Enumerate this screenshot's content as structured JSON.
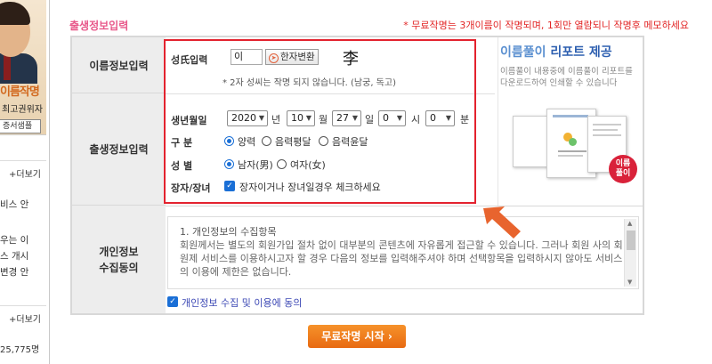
{
  "sidebar": {
    "banner_title": "이름작명",
    "banner_sub": "최고권위자",
    "sample_button": "증서샘플",
    "section1_more": "+더보기",
    "section1_lines": [
      "비스 안",
      "우는 이",
      "스 개시",
      "변경 안"
    ],
    "section2_more": "+더보기",
    "count": "25,775명"
  },
  "main": {
    "section_title": "출생정보입력",
    "notice": "* 무료작명는 3개이름이 작명되며, 1회만 열람되니 작명후 메모하세요",
    "labels": {
      "name_info": "이름정보입력",
      "birth_info": "출생정보입력",
      "privacy": "개인정보\n수집동의"
    }
  },
  "form": {
    "surname_label": "성氏입력",
    "surname_value": "이",
    "hanja_button": "한자변환",
    "hanja_char": "李",
    "surname_hint": "* 2자 성씨는 작명 되지 않습니다. (남궁, 독고)",
    "birth_label": "생년월일",
    "year": "2020",
    "year_unit": "년",
    "month": "10",
    "month_unit": "월",
    "day": "27",
    "day_unit": "일",
    "hour": "0",
    "hour_unit": "시",
    "minute": "0",
    "minute_unit": "분",
    "calendar_label": "구 분",
    "calendar_options": [
      "양력",
      "음력평달",
      "음력윤달"
    ],
    "calendar_selected": 0,
    "gender_label": "성 별",
    "gender_options": [
      "남자(男)",
      "여자(女)"
    ],
    "gender_selected": 0,
    "eldest_label": "장자/장녀",
    "eldest_text": "장자이거나 장녀일경우 체크하세요",
    "eldest_checked": true
  },
  "promo": {
    "title_light": "이름풀이",
    "title_bold": "리포트 제공",
    "description": "이름풀이 내용중에 이름풀이 리포트를 다운로드하여 인쇄할 수 있습니다",
    "badge": "이름\n풀이"
  },
  "consent": {
    "title": "1. 개인정보의 수집항목",
    "body": "회원께서는 별도의 회원가입 절차 없이 대부분의 콘텐츠에 자유롭게 접근할 수 있습니다. 그러나 회원 사의 회원제 서비스를 이용하시고자 할 경우 다음의 정보를 입력해주셔야 하며 선택항목을 입력하시지 않아도 서비스의 이용에 제한은 없습니다.",
    "agree_label": "개인정보 수집 및 이용에 동의",
    "agree_checked": true
  },
  "actions": {
    "start_button": "무료작명 시작 ›"
  },
  "colors": {
    "accent_pink": "#e8588a",
    "notice_red": "#e22525",
    "highlight_red": "#e3222e",
    "primary_blue": "#1a6fd6",
    "button_orange": "#e86a12",
    "arrow_orange": "#e8642e"
  }
}
